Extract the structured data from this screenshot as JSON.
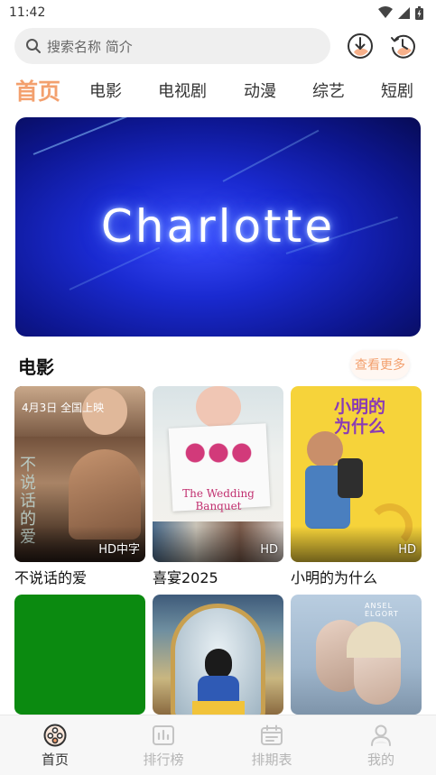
{
  "status": {
    "time": "11:42"
  },
  "search": {
    "placeholder": "搜索名称 简介"
  },
  "tabs": [
    {
      "label": "首页",
      "active": true
    },
    {
      "label": "电影"
    },
    {
      "label": "电视剧"
    },
    {
      "label": "动漫"
    },
    {
      "label": "综艺"
    },
    {
      "label": "短剧"
    }
  ],
  "banner": {
    "title": "Charlotte"
  },
  "section": {
    "title": "电影",
    "more_label": "查看更多"
  },
  "movies": [
    {
      "title": "不说话的爱",
      "badge": "HD中字",
      "poster_text": "不说话的爱",
      "poster_date": "4月3日 全国上映"
    },
    {
      "title": "喜宴2025",
      "badge": "HD",
      "poster_text": "The Wedding Banquet"
    },
    {
      "title": "小明的为什么",
      "badge": "HD",
      "poster_text": "小明的为什么"
    },
    {
      "title": "",
      "badge": ""
    },
    {
      "title": "",
      "badge": ""
    },
    {
      "title": "",
      "badge": "",
      "poster_text": "ANSEL ELGORT"
    }
  ],
  "nav": [
    {
      "label": "首页",
      "icon": "film-reel-icon",
      "active": true
    },
    {
      "label": "排行榜",
      "icon": "chart-icon"
    },
    {
      "label": "排期表",
      "icon": "calendar-icon"
    },
    {
      "label": "我的",
      "icon": "user-icon"
    }
  ],
  "colors": {
    "accent": "#f3a06e",
    "green_poster": "#0b8a10"
  }
}
